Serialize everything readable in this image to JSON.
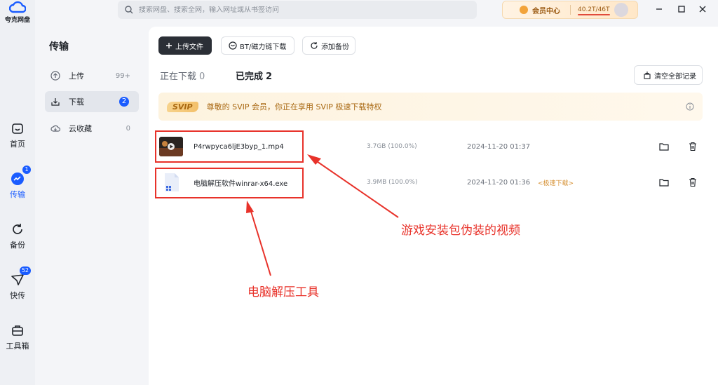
{
  "app": {
    "logo_text": "夸克网盘"
  },
  "rail": {
    "items": [
      {
        "label": "首页",
        "icon": "home-icon",
        "badge": ""
      },
      {
        "label": "传输",
        "icon": "transfer-icon",
        "badge": "1"
      },
      {
        "label": "备份",
        "icon": "backup-icon",
        "badge": ""
      },
      {
        "label": "快传",
        "icon": "quick-send-icon",
        "badge": "52"
      },
      {
        "label": "工具箱",
        "icon": "toolbox-icon",
        "badge": ""
      }
    ]
  },
  "subnav": {
    "title": "传输",
    "items": [
      {
        "label": "上传",
        "count": "99+",
        "icon": "upload-icon"
      },
      {
        "label": "下载",
        "count": "2",
        "icon": "download-icon"
      },
      {
        "label": "云收藏",
        "count": "0",
        "icon": "cloud-favorite-icon"
      }
    ]
  },
  "search": {
    "placeholder": "搜索网盘、搜索全网，输入网址或从书签访问"
  },
  "member": {
    "label": "会员中心",
    "storage": "40.2T/46T"
  },
  "toolbar": {
    "upload_label": "上传文件",
    "bt_label": "BT/磁力链下载",
    "backup_label": "添加备份"
  },
  "tabs": {
    "downloading_label": "正在下载",
    "downloading_count": "0",
    "completed_label": "已完成",
    "completed_count": "2"
  },
  "clear_label": "清空全部记录",
  "svip": {
    "tag": "SVIP",
    "text": "尊敬的 SVIP 会员，你正在享用 SVIP 极速下载特权"
  },
  "files": [
    {
      "name": "P4rwpyca6ljE3byp_1.mp4",
      "size": "3.7GB (100.0%)",
      "date": "2024-11-20 01:37",
      "speed_tag": ""
    },
    {
      "name": "电脑解压软件winrar-x64.exe",
      "size": "3.9MB (100.0%)",
      "date": "2024-11-20 01:36",
      "speed_tag": "<极速下载>"
    }
  ],
  "annotations": {
    "video_note": "游戏安装包伪装的视频",
    "tool_note": "电脑解压工具"
  },
  "colors": {
    "accent": "#1a5cff",
    "annotation": "#e8322a",
    "svip_text": "#a86710"
  }
}
